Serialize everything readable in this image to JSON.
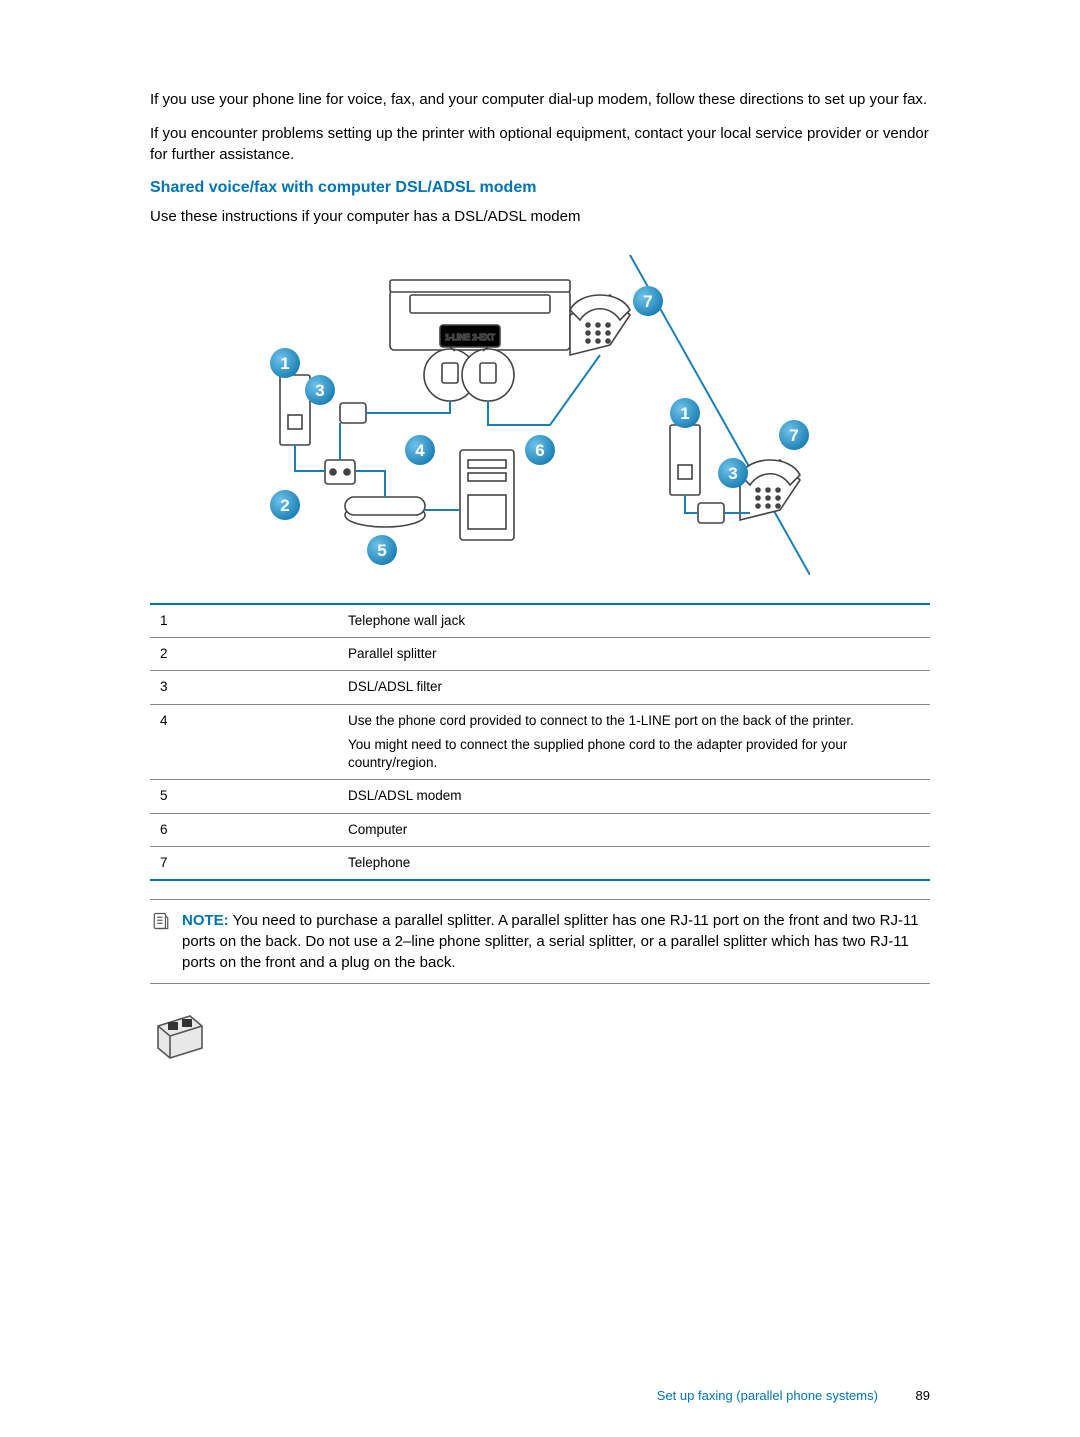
{
  "intro": {
    "p1": "If you use your phone line for voice, fax, and your computer dial-up modem, follow these directions to set up your fax.",
    "p2": "If you encounter problems setting up the printer with optional equipment, contact your local service provider or vendor for further assistance."
  },
  "heading": "Shared voice/fax with computer DSL/ADSL modem",
  "subtext": "Use these instructions if your computer has a DSL/ADSL modem",
  "diagram_labels": {
    "callouts": [
      "1",
      "2",
      "3",
      "4",
      "5",
      "6",
      "7"
    ],
    "port_label": "1-LINE 2-EXT"
  },
  "legend": [
    {
      "num": "1",
      "desc": "Telephone wall jack"
    },
    {
      "num": "2",
      "desc": "Parallel splitter"
    },
    {
      "num": "3",
      "desc": "DSL/ADSL filter"
    },
    {
      "num": "4",
      "desc": "Use the phone cord provided to connect to the 1-LINE port on the back of the printer.",
      "desc2": "You might need to connect the supplied phone cord to the adapter provided for your country/region."
    },
    {
      "num": "5",
      "desc": "DSL/ADSL modem"
    },
    {
      "num": "6",
      "desc": "Computer"
    },
    {
      "num": "7",
      "desc": "Telephone"
    }
  ],
  "note": {
    "label": "NOTE:",
    "text": "You need to purchase a parallel splitter. A parallel splitter has one RJ-11 port on the front and two RJ-11 ports on the back. Do not use a 2–line phone splitter, a serial splitter, or a parallel splitter which has two RJ-11 ports on the front and a plug on the back."
  },
  "footer": {
    "section": "Set up faxing (parallel phone systems)",
    "page": "89"
  }
}
